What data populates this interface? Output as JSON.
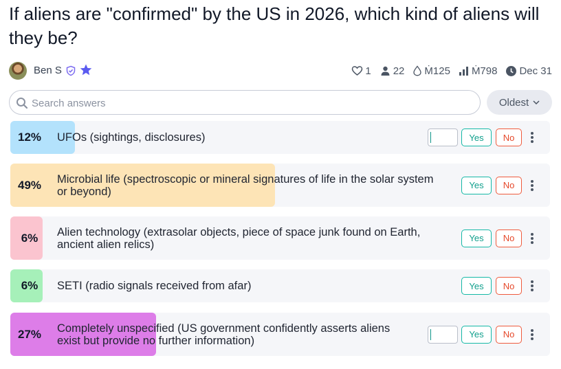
{
  "question": {
    "title": "If aliens are \"confirmed\" by the US in 2026, which kind of aliens will they be?"
  },
  "author": {
    "name": "Ben S"
  },
  "stats": {
    "likes": "1",
    "traders": "22",
    "liquidity": "Ṁ125",
    "volume": "Ṁ798",
    "close_date": "Dec 31"
  },
  "search": {
    "placeholder": "Search answers"
  },
  "sort": {
    "label": "Oldest"
  },
  "buttons": {
    "yes": "Yes",
    "no": "No"
  },
  "answers": [
    {
      "pct_label": "12%",
      "probability": 0.12,
      "text": "UFOs (sightings, disclosures)",
      "color": "#b3e2fc",
      "has_position": true
    },
    {
      "pct_label": "49%",
      "probability": 0.49,
      "text": "Microbial life (spectroscopic or mineral signatures of life in the solar system or beyond)",
      "color": "#fde4b6",
      "has_position": false
    },
    {
      "pct_label": "6%",
      "probability": 0.06,
      "text": "Alien technology (extrasolar objects, piece of space junk found on Earth, ancient alien relics)",
      "color": "#fbc4cf",
      "has_position": false
    },
    {
      "pct_label": "6%",
      "probability": 0.06,
      "text": "SETI (radio signals received from afar)",
      "color": "#a6f0b9",
      "has_position": false
    },
    {
      "pct_label": "27%",
      "probability": 0.27,
      "text": "Completely unspecified (US government confidently asserts aliens exist but provide no further information)",
      "color": "#dd7de8",
      "has_position": true
    }
  ],
  "colors": {
    "yes": "#14b8a6",
    "no": "#ef5a3c",
    "star": "#5b5bf0",
    "shield": "#7c6cf0"
  }
}
